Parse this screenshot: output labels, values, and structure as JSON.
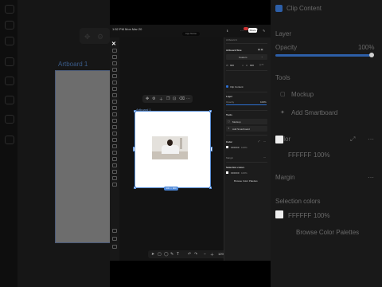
{
  "background": {
    "artboard_label": "Artboard 1",
    "right": {
      "clip_content": "Clip Content",
      "layer": "Layer",
      "opacity": "Opacity",
      "opacity_value": "100%",
      "opacity_level": 1.0,
      "tools": "Tools",
      "mockup": "Mockup",
      "add_smartboard": "Add Smartboard",
      "color": "Color",
      "color_hex": "FFFFFF",
      "color_opacity": "100%",
      "color_swatch": "#FFFFFF",
      "margin": "Margin",
      "selection_colors": "Selection colors",
      "sel_hex": "FFFFFF",
      "sel_opacity": "100%",
      "browse": "Browse Color Palettes"
    }
  },
  "status": {
    "time": "1:52 PM  Mon Mar 20",
    "battery": "68%",
    "pill": "App Name"
  },
  "canvas": {
    "artboard_label": "Artboard 1",
    "dim_badge": "900 × 900"
  },
  "bottom_bar": {
    "zoom": "10%"
  },
  "panel": {
    "layer_name": "Artboard 1",
    "board_title": "Artboard Size",
    "preset": "Custom",
    "width": "900",
    "height": "900",
    "clip": "Clip Content",
    "layer": "Layer",
    "opacity": "Opacity",
    "opacity_value": "100%",
    "tools": "Tools",
    "mockup": "Mockup",
    "smartboard": "Add Smartboard",
    "color": "Color",
    "color_hex": "FFFFFF",
    "color_opacity": "100%",
    "margin": "Margin",
    "selection_colors": "Selection colors",
    "sel_hex": "FFFFFF",
    "sel_opacity": "100%",
    "browse": "Browse Color Palettes",
    "share": "Share"
  },
  "colors": {
    "accent": "#2d6fd1",
    "selection": "#5b8fd6",
    "artboard_fill": "#ffffff"
  }
}
